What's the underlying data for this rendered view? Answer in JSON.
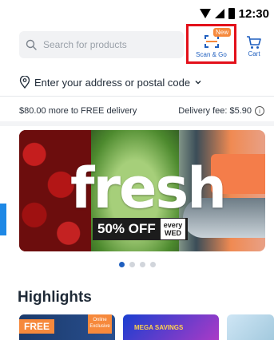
{
  "status_bar": {
    "time": "12:30"
  },
  "search": {
    "placeholder": "Search for products"
  },
  "scan_go": {
    "label": "Scan & Go",
    "badge": "New"
  },
  "cart": {
    "label": "Cart"
  },
  "address": {
    "label": "Enter your address or postal code"
  },
  "delivery": {
    "threshold": "$80.00 more to FREE delivery",
    "fee": "Delivery fee: $5.90"
  },
  "banner": {
    "headline": "fresh",
    "promo_percent": "50% OFF",
    "promo_day_1": "every",
    "promo_day_2": "WED"
  },
  "carousel": {
    "dots": 4,
    "active": 0
  },
  "highlights": {
    "title": "Highlights",
    "tiles": [
      {
        "badge": "FREE",
        "tag": "Online Exclusive"
      },
      {
        "tag": "MEGA SAVINGS"
      },
      {
        "tag": ""
      }
    ]
  },
  "colors": {
    "brand_blue": "#1f5fbf",
    "highlight_red": "#e3101a",
    "accent_orange": "#f6893c"
  }
}
